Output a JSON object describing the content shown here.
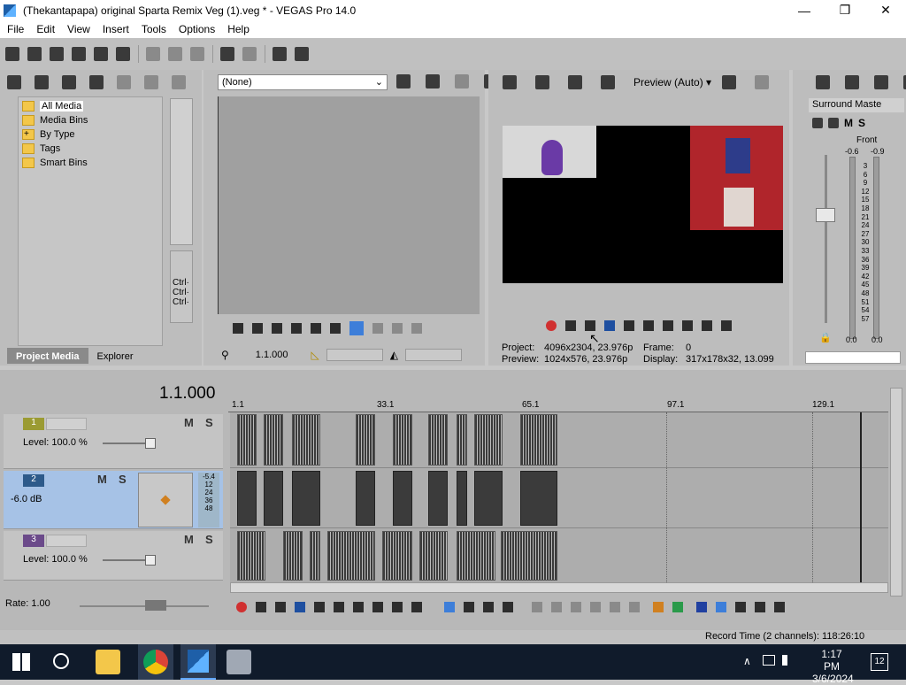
{
  "window": {
    "title": "(Thekantapapa) original Sparta Remix Veg (1).veg * - VEGAS Pro 14.0",
    "min": "—",
    "max": "❐",
    "close": "✕"
  },
  "menu": [
    "File",
    "Edit",
    "View",
    "Insert",
    "Tools",
    "Options",
    "Help"
  ],
  "project_media": {
    "tree": [
      "All Media",
      "Media Bins",
      "By Type",
      "Tags",
      "Smart Bins"
    ],
    "expander": "+",
    "tabs": [
      "Project Media",
      "Explorer"
    ],
    "side_lines": [
      "Ctrl·",
      "Ctrl·",
      "Ctrl·"
    ]
  },
  "trimmer": {
    "dropdown": "(None)",
    "timecode": "1.1.000"
  },
  "preview": {
    "mode": "Preview (Auto)",
    "project_label": "Project:",
    "project_value": "4096x2304, 23.976p",
    "preview_label": "Preview:",
    "preview_value": "1024x576, 23.976p",
    "frame_label": "Frame:",
    "frame_value": "0",
    "display_label": "Display:",
    "display_value": "317x178x32, 13.099"
  },
  "master": {
    "title": "Surround Maste",
    "m": "M",
    "s": "S",
    "front": "Front",
    "peak_l": "-0.6",
    "peak_r": "-0.9",
    "scale": [
      "3",
      "6",
      "9",
      "12",
      "15",
      "18",
      "21",
      "24",
      "27",
      "30",
      "33",
      "36",
      "39",
      "42",
      "45",
      "48",
      "51",
      "54",
      "57"
    ],
    "bottom_l": "0.0",
    "bottom_r": "0.0"
  },
  "timeline": {
    "cursor": "1.1.000",
    "ruler": [
      "1.1",
      "33.1",
      "65.1",
      "97.1",
      "129.1"
    ],
    "tracks": [
      {
        "num": "1",
        "level": "Level: 100.0 %",
        "m": "M",
        "s": "S"
      },
      {
        "num": "2",
        "level": "-6.0 dB",
        "m": "M",
        "s": "S",
        "meter": [
          "-5.4",
          "12",
          "24",
          "36",
          "48"
        ]
      },
      {
        "num": "3",
        "level": "Level: 100.0 %",
        "m": "M",
        "s": "S"
      }
    ],
    "rate": "Rate: 1.00",
    "record_time": "Record Time (2 channels): 118:26:10"
  },
  "taskbar": {
    "time": "1:17 PM",
    "date": "3/6/2024",
    "notifications": "12"
  },
  "colors": {
    "accent": "#3d7ed9",
    "track_selected": "#a6c2e6",
    "taskbar": "#101b2b"
  }
}
